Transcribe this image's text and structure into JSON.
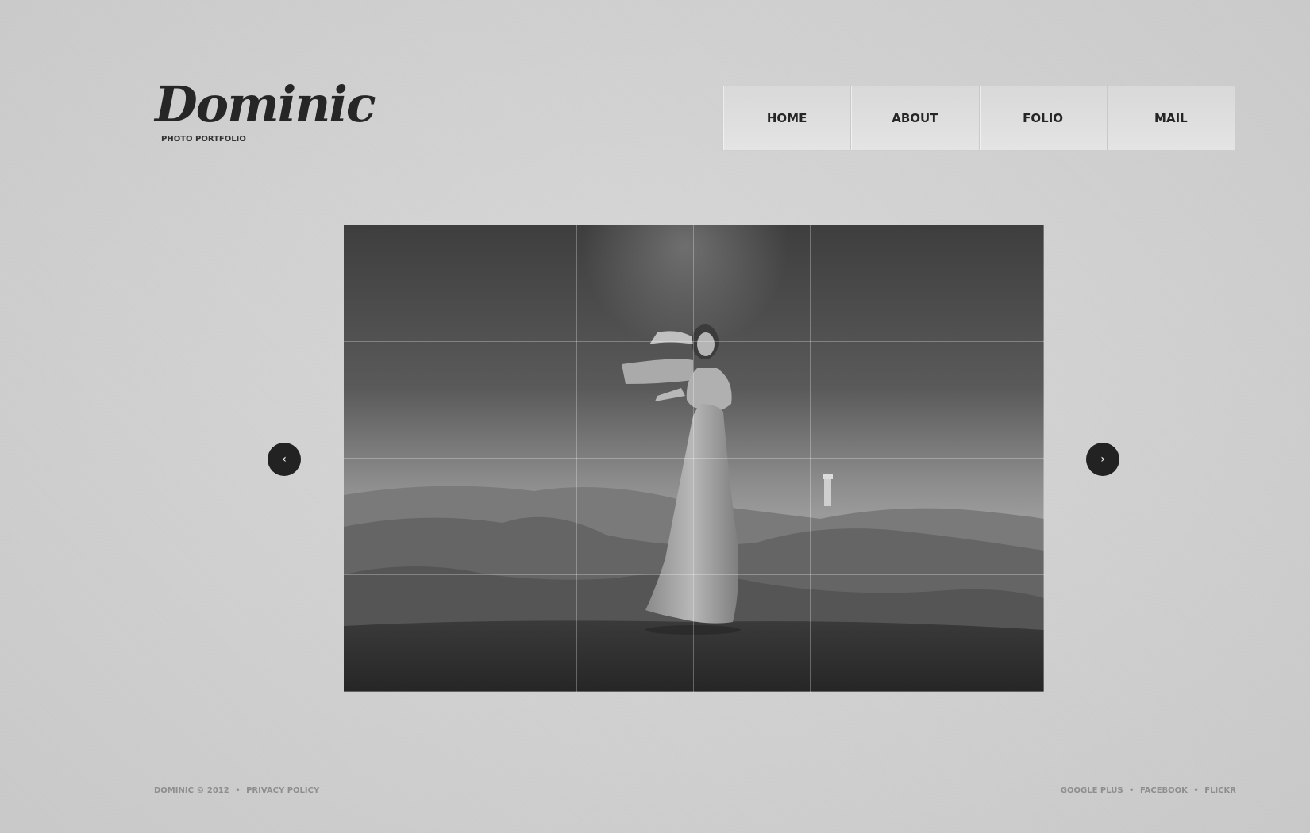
{
  "logo": {
    "name": "Dominic",
    "tagline": "PHOTO PORTFOLIO"
  },
  "nav": {
    "items": [
      {
        "label": "HOME"
      },
      {
        "label": "ABOUT"
      },
      {
        "label": "FOLIO"
      },
      {
        "label": "MAIL"
      }
    ]
  },
  "slider": {
    "prev_icon": "chevron-left-icon",
    "next_icon": "chevron-right-icon",
    "prev_glyph": "‹",
    "next_glyph": "›"
  },
  "footer": {
    "brand": "DOMINIC",
    "copyright": "© 2012",
    "bullet": "•",
    "privacy": "PRIVACY POLICY",
    "social": {
      "google_plus": "GOOGLE PLUS",
      "facebook": "FACEBOOK",
      "flickr": "FLICKR"
    }
  },
  "colors": {
    "background": "#e7e7e7",
    "text_dark": "#262626",
    "footer_text": "#8e8e8e",
    "arrow_bg": "#222222"
  }
}
